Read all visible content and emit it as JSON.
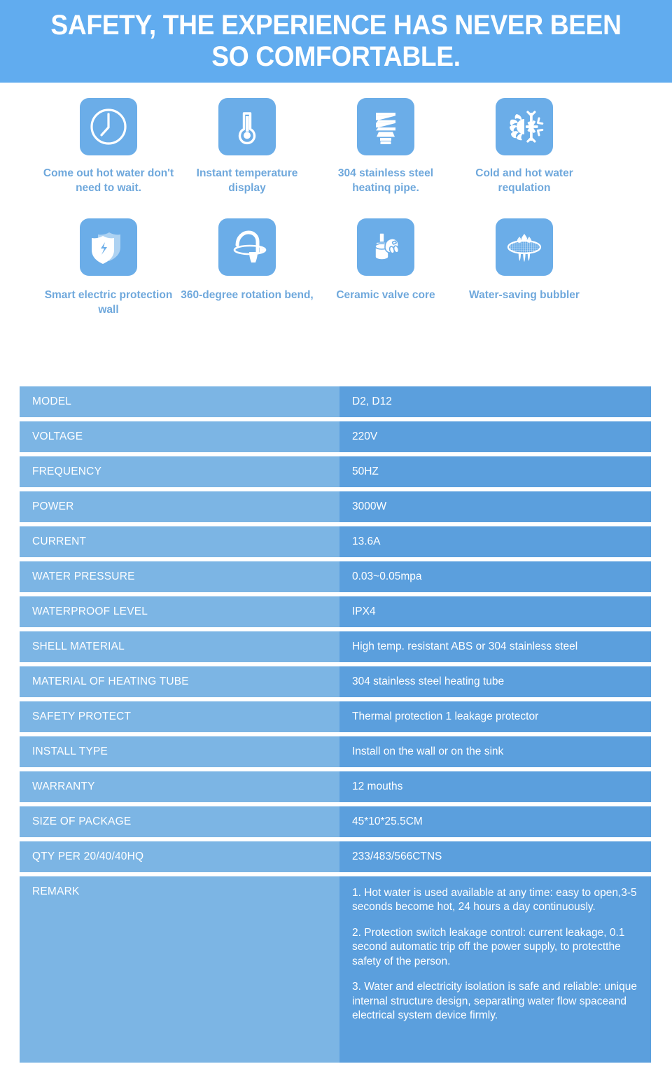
{
  "banner": {
    "title": "SAFETY, THE EXPERIENCE HAS NEVER BEEN SO COMFORTABLE."
  },
  "colors": {
    "banner_blue": "#61ACEF",
    "tile_blue": "#6BADE8",
    "caption_blue": "#6FA8DC",
    "cell_key_blue": "#7CB5E4",
    "cell_value_blue": "#5B9FDD",
    "text_white": "#FFFFFF"
  },
  "features": [
    {
      "icon": "clock-icon",
      "label": "Come out hot water don't need to wait."
    },
    {
      "icon": "thermometer-icon",
      "label": "Instant temperature display"
    },
    {
      "icon": "heating-coil-icon",
      "label": "304 stainless steel heatinq pipe."
    },
    {
      "icon": "sun-snowflake-icon",
      "label": "Cold and hot water requlation"
    },
    {
      "icon": "shield-bolt-icon",
      "label": "Smart electric protection wall"
    },
    {
      "icon": "rotating-faucet-icon",
      "label": "360-degree rotation bend,"
    },
    {
      "icon": "valve-core-icon",
      "label": "Ceramic valve core"
    },
    {
      "icon": "bubbler-icon",
      "label": "Water-saving bubbler"
    }
  ],
  "spec_table": {
    "rows": [
      {
        "key": "MODEL",
        "value": "D2, D12"
      },
      {
        "key": "VOLTAGE",
        "value": "220V"
      },
      {
        "key": "FREQUENCY",
        "value": "50HZ"
      },
      {
        "key": "POWER",
        "value": "3000W"
      },
      {
        "key": "CURRENT",
        "value": "13.6A"
      },
      {
        "key": "WATER PRESSURE",
        "value": "0.03~0.05mpa"
      },
      {
        "key": "WATERPROOF LEVEL",
        "value": "IPX4"
      },
      {
        "key": " SHELL MATERIAL",
        "value": "High temp. resistant ABS  or 304 stainless steel"
      },
      {
        "key": "MATERIAL OF HEATING TUBE",
        "value": "304 stainless steel heating tube"
      },
      {
        "key": "SAFETY PROTECT",
        "value": "Thermal protection 1 leakage protector"
      },
      {
        "key": "INSTALL TYPE",
        "value": "Install on the wall or on the sink"
      },
      {
        "key": "WARRANTY",
        "value": "12 mouths"
      },
      {
        "key": "SIZE OF PACKAGE",
        "value": "45*10*25.5CM"
      },
      {
        "key": "QTY PER 20/40/40HQ",
        "value": "233/483/566CTNS"
      }
    ],
    "remark": {
      "key": "REMARK",
      "items": [
        "1. Hot water is used available at any time: easy to open,3-5 seconds become hot, 24 hours a day continuously.",
        "2. Protection switch leakage control: current leakage, 0.1 second automatic trip off the power supply, to protectthe safety of the person.",
        "3. Water and electricity isolation is safe and reliable: unique internal structure design, separating water flow spaceand electrical system device firmly."
      ]
    }
  }
}
